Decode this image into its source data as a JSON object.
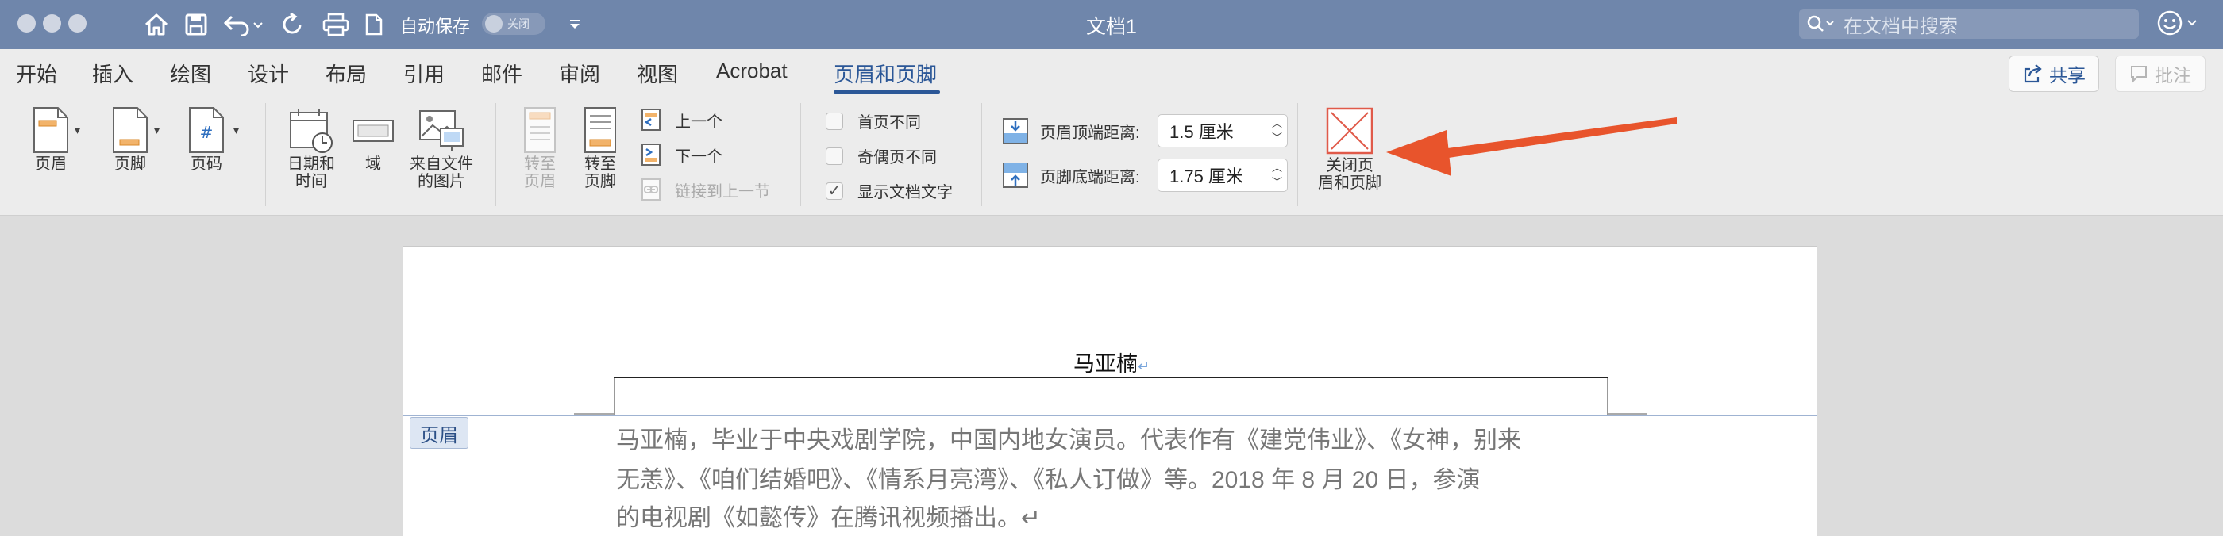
{
  "window": {
    "title": "文档1",
    "autosave_label": "自动保存",
    "autosave_state": "关闭",
    "search_placeholder": "在文档中搜索"
  },
  "tabs": [
    "开始",
    "插入",
    "绘图",
    "设计",
    "布局",
    "引用",
    "邮件",
    "审阅",
    "视图",
    "Acrobat",
    "页眉和页脚"
  ],
  "active_tab": "页眉和页脚",
  "top_right": {
    "share": "共享",
    "comment": "批注"
  },
  "ribbon": {
    "header": "页眉",
    "footer": "页脚",
    "page_number": "页码",
    "date_time_1": "日期和",
    "date_time_2": "时间",
    "field": "域",
    "picture_1": "来自文件",
    "picture_2": "的图片",
    "goto_header_1": "转至",
    "goto_header_2": "页眉",
    "goto_footer_1": "转至",
    "goto_footer_2": "页脚",
    "previous": "上一个",
    "next": "下一个",
    "link_previous": "链接到上一节",
    "diff_first_page": "首页不同",
    "diff_odd_even": "奇偶页不同",
    "show_doc_text": "显示文档文字",
    "header_from_top_label": "页眉顶端距离:",
    "header_from_top_value": "1.5 厘米",
    "footer_from_bottom_label": "页脚底端距离:",
    "footer_from_bottom_value": "1.75 厘米",
    "close_1": "关闭页",
    "close_2": "眉和页脚"
  },
  "document": {
    "header_text": "马亚楠",
    "header_tag": "页眉",
    "body_lines": [
      "马亚楠，毕业于中央戏剧学院，中国内地女演员。代表作有《建党伟业》、《女神，别来",
      "无恙》、《咱们结婚吧》、《情系月亮湾》、《私人订做》等。2018 年 8 月 20 日，参演",
      "的电视剧《如懿传》在腾讯视频播出。↵"
    ]
  },
  "colors": {
    "titlebar": "#6f86ab",
    "accent": "#2b5797",
    "arrow": "#e8542c",
    "close_icon": "#e05a4a"
  }
}
